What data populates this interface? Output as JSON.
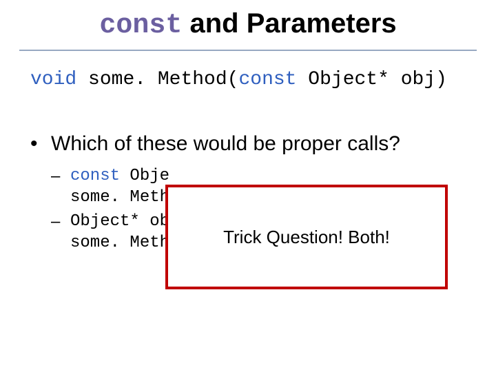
{
  "title": {
    "keyword": "const",
    "rest": " and Parameters"
  },
  "signature": {
    "kw_void": "void",
    "sp1": " ",
    "fn": "some. Method(",
    "kw_const": "const",
    "sp2": " ",
    "rest": "Object* obj)"
  },
  "question": "Which of these would be proper calls?",
  "options": [
    {
      "line1_kw": "const",
      "line1_rest": " Obje",
      "line2": "some. Method"
    },
    {
      "line1": "Object* ob",
      "line2": "some. Method"
    }
  ],
  "callout": "Trick Question!  Both!"
}
